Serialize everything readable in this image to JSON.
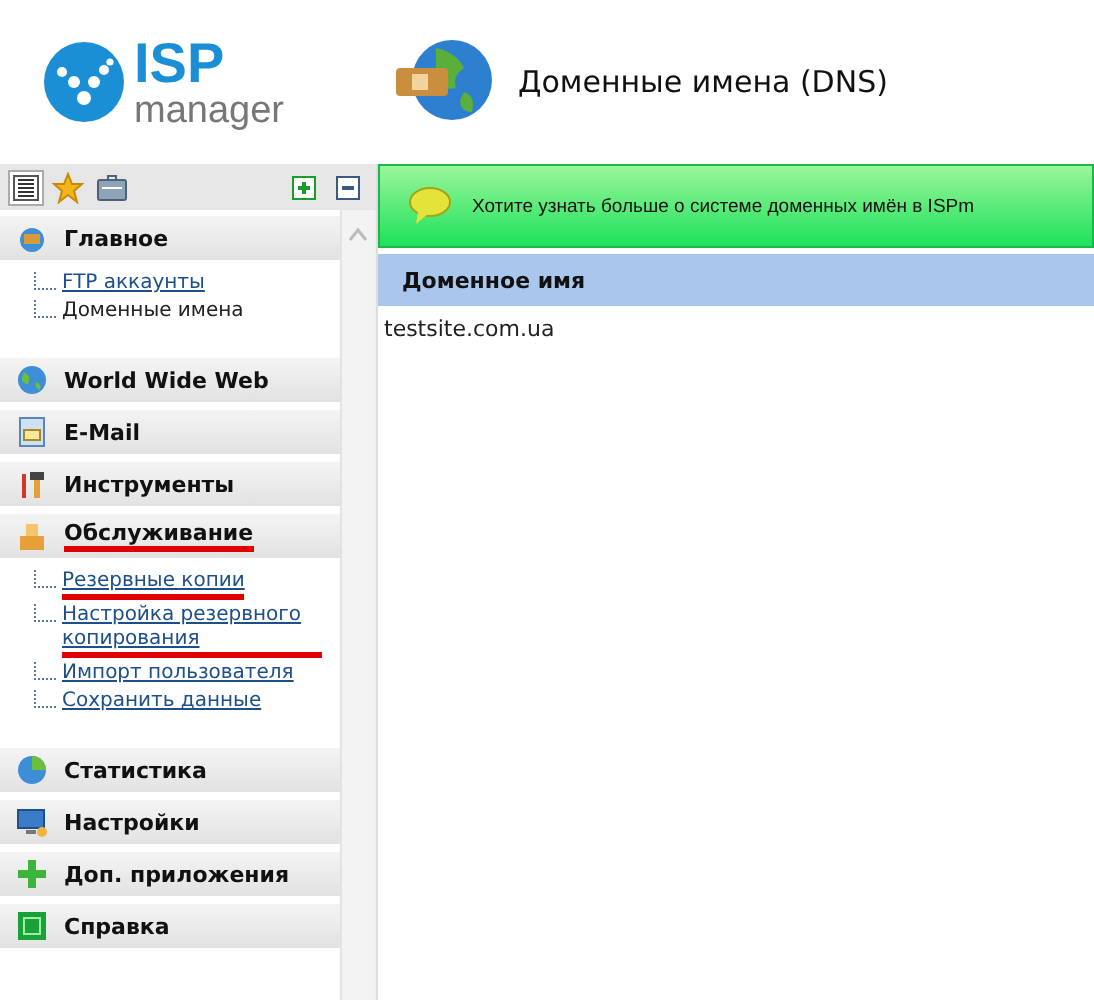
{
  "logo": {
    "brand": "ISP",
    "product": "manager"
  },
  "page_title": "Доменные имена (DNS)",
  "sidebar": {
    "tabs": [
      {
        "selected": true
      },
      {
        "selected": false
      },
      {
        "selected": false
      }
    ],
    "sections": [
      {
        "title": "Главное",
        "children": [
          {
            "label": "FTP аккаунты",
            "link": true,
            "highlighted": false
          },
          {
            "label": "Доменные имена",
            "link": false,
            "highlighted": false
          }
        ]
      },
      {
        "title": "World Wide Web"
      },
      {
        "title": "E-Mail"
      },
      {
        "title": "Инструменты"
      },
      {
        "title": "Обслуживание",
        "highlighted": true,
        "children": [
          {
            "label": "Резервные копии",
            "link": true,
            "highlighted": true
          },
          {
            "label": "Настройка резервного копирования",
            "link": true,
            "highlighted": true
          },
          {
            "label": "Импорт пользователя",
            "link": true,
            "highlighted": false
          },
          {
            "label": "Сохранить данные",
            "link": true,
            "highlighted": false
          }
        ]
      },
      {
        "title": "Статистика"
      },
      {
        "title": "Настройки"
      },
      {
        "title": "Доп. приложения"
      },
      {
        "title": "Справка"
      }
    ]
  },
  "banner": "Хотите узнать больше о системе доменных имён в ISPm",
  "table": {
    "columns": [
      "Доменное имя"
    ],
    "rows": [
      [
        "testsite.com.ua"
      ]
    ]
  }
}
